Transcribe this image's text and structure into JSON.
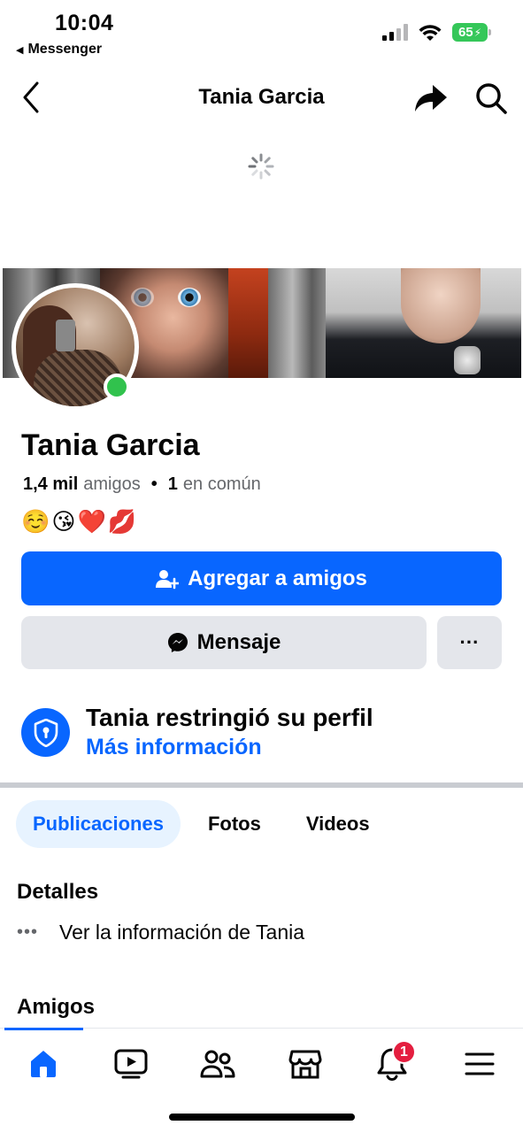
{
  "status_bar": {
    "time": "10:04",
    "back_app": "Messenger",
    "battery": "65"
  },
  "header": {
    "title": "Tania Garcia"
  },
  "profile": {
    "name": "Tania Garcia",
    "friends_count": "1,4 mil",
    "friends_label": "amigos",
    "mutual_count": "1",
    "mutual_label": "en común",
    "bio": "☺️😘❤️💋",
    "online": true
  },
  "actions": {
    "add_friend": "Agregar a amigos",
    "message": "Mensaje",
    "more": "···"
  },
  "restriction": {
    "title": "Tania restringió su perfil",
    "link": "Más información"
  },
  "tabs": [
    {
      "label": "Publicaciones",
      "active": true
    },
    {
      "label": "Fotos",
      "active": false
    },
    {
      "label": "Videos",
      "active": false
    }
  ],
  "details": {
    "title": "Detalles",
    "row_dots": "•••",
    "row_text": "Ver la información de Tania"
  },
  "friends_section": {
    "title": "Amigos"
  },
  "bottom_nav": {
    "notifications_badge": "1",
    "items": [
      "home-icon",
      "video-icon",
      "friends-icon",
      "marketplace-icon",
      "bell-icon",
      "menu-icon"
    ]
  },
  "colors": {
    "accent": "#0866ff",
    "button_gray": "#e4e6eb",
    "online": "#31c24d",
    "badge": "#e41e3f"
  }
}
